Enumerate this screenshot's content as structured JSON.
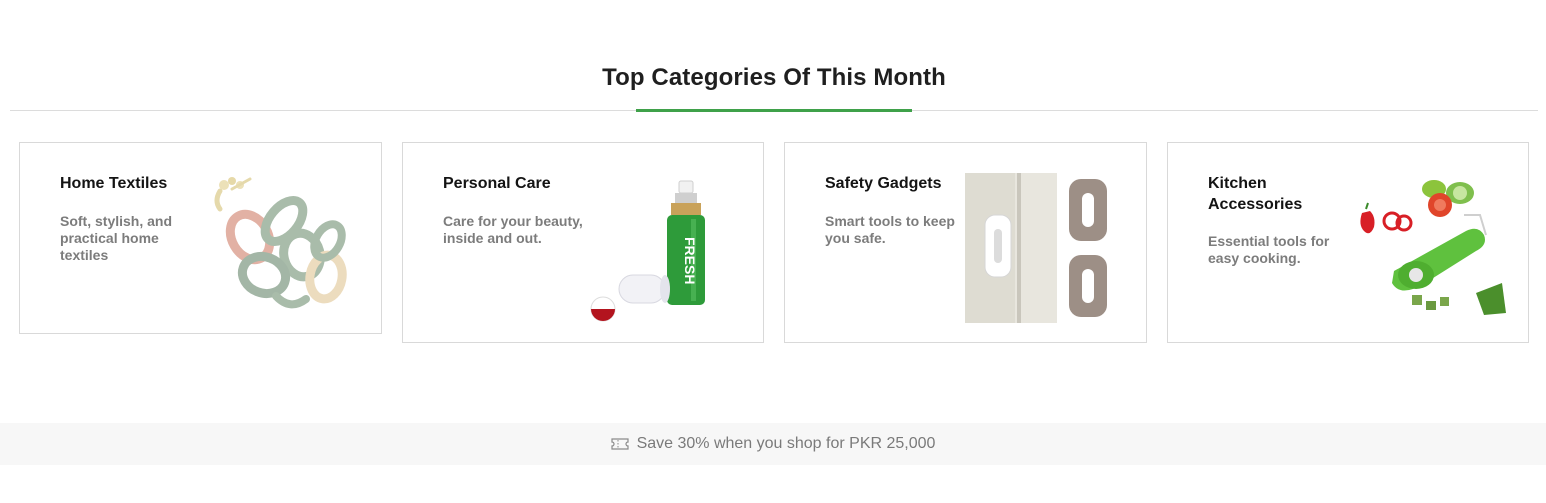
{
  "section": {
    "title": "Top Categories Of This Month"
  },
  "categories": [
    {
      "title": "Home Textiles",
      "description": "Soft, stylish, and practical home textiles",
      "icon": "clothes-hangers-image"
    },
    {
      "title": "Personal Care",
      "description": "Care for your beauty, inside and out.",
      "icon": "spray-bottle-image",
      "product_text": "FRESH"
    },
    {
      "title": "Safety Gadgets",
      "description": "Smart tools to keep you safe.",
      "icon": "door-stopper-image"
    },
    {
      "title": "Kitchen Accessories",
      "description": "Essential tools for easy cooking.",
      "icon": "vegetable-cutter-image"
    }
  ],
  "promo": {
    "icon": "ticket-icon",
    "text": "Save 30% when you shop for PKR 25,000"
  },
  "colors": {
    "accent": "#3fa14a",
    "border": "#d9d9d9",
    "muted_text": "#7c7c7c",
    "promo_bg": "#f7f7f7"
  }
}
